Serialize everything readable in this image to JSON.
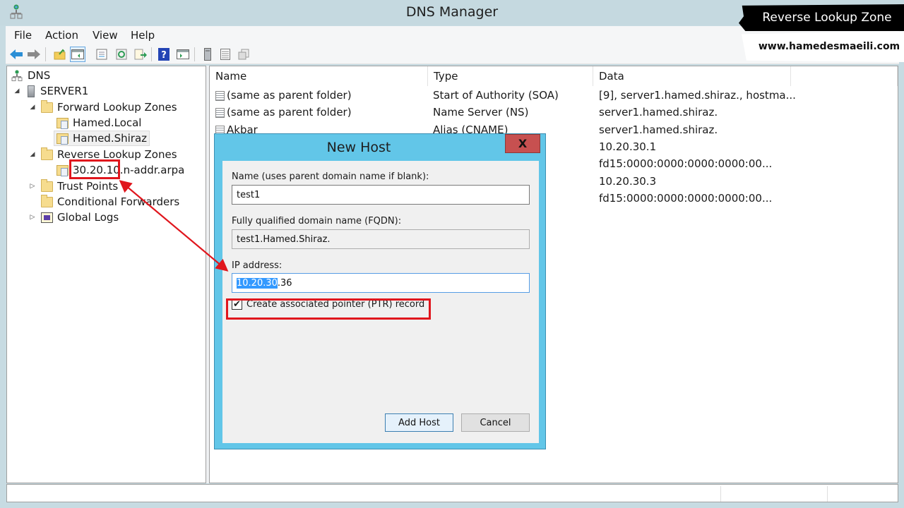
{
  "window": {
    "title": "DNS Manager",
    "app_icon": "dns-manager-icon"
  },
  "menu": {
    "items": [
      "File",
      "Action",
      "View",
      "Help"
    ]
  },
  "toolbar": {
    "buttons": [
      {
        "icon": "back-arrow-icon",
        "color": "#2b8fd6"
      },
      {
        "icon": "forward-arrow-icon",
        "color": "#8a8a8a"
      },
      {
        "icon": "up-folder-icon"
      },
      {
        "icon": "show-hide-console-tree-icon",
        "active": true
      },
      {
        "icon": "properties-icon"
      },
      {
        "icon": "refresh-icon"
      },
      {
        "icon": "export-list-icon"
      },
      {
        "icon": "help-icon"
      },
      {
        "icon": "show-action-pane-icon"
      },
      {
        "icon": "server-icon"
      },
      {
        "icon": "record-list-icon"
      },
      {
        "icon": "copy-icon"
      }
    ]
  },
  "tree": {
    "root": "DNS",
    "server": "SERVER1",
    "forward_zones": "Forward Lookup Zones",
    "forward_children": [
      "Hamed.Local",
      "Hamed.Shiraz"
    ],
    "selected": "Hamed.Shiraz",
    "reverse_zones": "Reverse Lookup Zones",
    "reverse_child_prefix": "30.20.10.",
    "reverse_child_suffix": "n-addr.arpa",
    "trust_points": "Trust Points",
    "conditional_forwarders": "Conditional Forwarders",
    "global_logs": "Global Logs"
  },
  "list": {
    "columns": [
      "Name",
      "Type",
      "Data"
    ],
    "rows": [
      {
        "name": "(same as parent folder)",
        "type": "Start of Authority (SOA)",
        "data": "[9], server1.hamed.shiraz., hostma..."
      },
      {
        "name": "(same as parent folder)",
        "type": "Name Server (NS)",
        "data": "server1.hamed.shiraz."
      },
      {
        "name": "Akbar",
        "type": "Alias (CNAME)",
        "data": "server1.hamed.shiraz."
      },
      {
        "name": "",
        "type": "",
        "data": "10.20.30.1"
      },
      {
        "name": "",
        "type": "",
        "data": "fd15:0000:0000:0000:0000:00..."
      },
      {
        "name": "",
        "type": "",
        "data": "10.20.30.3"
      },
      {
        "name": "",
        "type": "",
        "data": "fd15:0000:0000:0000:0000:00..."
      }
    ]
  },
  "dialog": {
    "title": "New Host",
    "close_label": "X",
    "name_label": "Name (uses parent domain name if blank):",
    "name_value": "test1",
    "fqdn_label": "Fully qualified domain name (FQDN):",
    "fqdn_value": "test1.Hamed.Shiraz.",
    "ip_label": "IP address:",
    "ip_selected_part": "10.20.30",
    "ip_rest": ".36",
    "ptr_checked": true,
    "ptr_check_glyph": "✔",
    "ptr_label": "Create associated pointer (PTR) record",
    "add_button": "Add Host",
    "cancel_button": "Cancel"
  },
  "annotation": {
    "banner_title": "Reverse Lookup Zone",
    "banner_url": "www.hamedesmaeili.com",
    "highlight_color": "#e0161d"
  }
}
